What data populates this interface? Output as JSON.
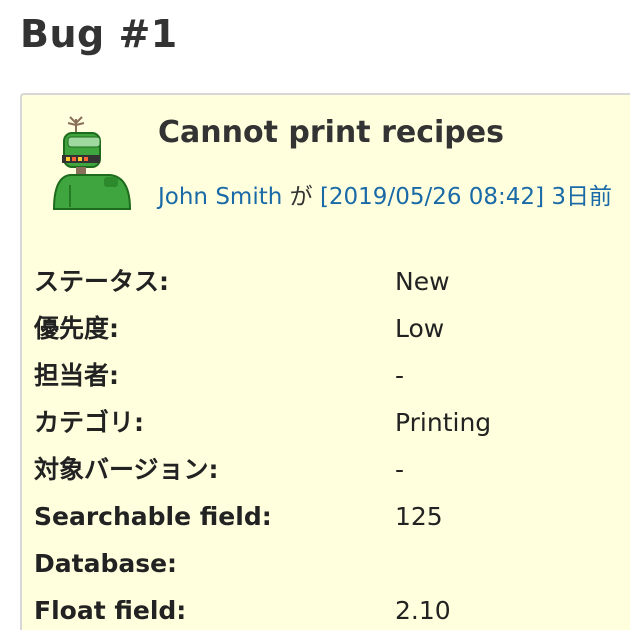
{
  "page": {
    "title": "Bug #1"
  },
  "issue": {
    "subject": "Cannot print recipes",
    "author_name": "John Smith",
    "author_separator": "が",
    "created_at": "[2019/05/26 08:42]",
    "age_text": "3日前",
    "avatar_icon": "robot-avatar-icon"
  },
  "attributes": [
    {
      "label": "ステータス:",
      "value": "New"
    },
    {
      "label": "優先度:",
      "value": "Low"
    },
    {
      "label": "担当者:",
      "value": "-"
    },
    {
      "label": "カテゴリ:",
      "value": "Printing"
    },
    {
      "label": "対象バージョン:",
      "value": "-"
    },
    {
      "label": "Searchable field:",
      "value": "125"
    },
    {
      "label": "Database:",
      "value": ""
    },
    {
      "label": "Float field:",
      "value": "2.10"
    }
  ],
  "colors": {
    "box_background": "#ffffdd",
    "link": "#1a6aa8",
    "border": "#d7d7d7"
  }
}
